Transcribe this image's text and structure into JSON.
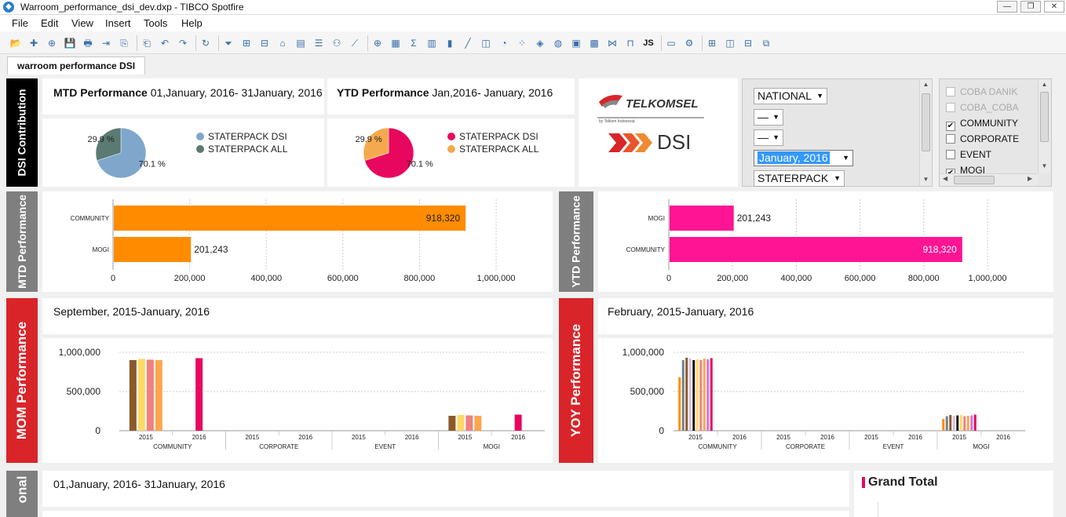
{
  "window": {
    "title": "Warroom_performance_dsi_dev.dxp - TIBCO Spotfire",
    "min": "—",
    "max": "❐",
    "close": "✕"
  },
  "menu": [
    "File",
    "Edit",
    "View",
    "Insert",
    "Tools",
    "Help"
  ],
  "toolbar_icons": [
    "open-icon",
    "new-icon",
    "add-data-icon",
    "save-icon",
    "print-icon",
    "export-icon",
    "copy-icon",
    "paste-icon",
    "undo-icon",
    "redo-icon",
    "reload-icon",
    "filter-icon",
    "details-icon",
    "bookmark-icon",
    "tag-icon",
    "page-icon",
    "lists-icon",
    "collaboration-icon",
    "trend-icon",
    "new-page-icon",
    "table-icon",
    "crosstable-icon",
    "graphical-table-icon",
    "bar-chart-icon",
    "line-chart-icon",
    "combination-chart-icon",
    "pie-chart-icon",
    "scatter-icon",
    "3d-scatter-icon",
    "map-icon",
    "treemap-icon",
    "heatmap-icon",
    "parallel-coordinates-icon",
    "box-plot-icon",
    "js-icon",
    "text-area-icon",
    "settings-icon",
    "layout-icon-1",
    "layout-icon-2",
    "layout-icon-3",
    "layout-icon-4"
  ],
  "tab": "warroom performance DSI",
  "colors": {
    "blue": "#7fa7cc",
    "slate": "#5a7a72",
    "pink": "#e8075f",
    "peach": "#f5a94e",
    "orange": "#ff8c00",
    "gray_label": "#7f7f7f",
    "red_label": "#d9252a",
    "black_label": "#000000"
  },
  "dsi_contribution": {
    "label": "DSI Contribution",
    "mtd": {
      "title_bold": "MTD Performance",
      "title_rest": " 01,January, 2016- 31January, 2016",
      "legend": [
        "STATERPACK DSI",
        "STATERPACK ALL"
      ]
    },
    "ytd": {
      "title_bold": "YTD Performance",
      "title_rest": " Jan,2016- January, 2016",
      "legend": [
        "STATERPACK DSI",
        "STATERPACK ALL"
      ]
    }
  },
  "logo": {
    "brand": "TELKOMSEL",
    "sub": "by Telkom Indonesia",
    "product": "DSI"
  },
  "filters": {
    "dropdowns": [
      "NATIONAL",
      "—",
      "—",
      "January, 2016",
      "STATERPACK"
    ],
    "checkboxes": [
      {
        "label": "COBA DANIK",
        "checked": false,
        "dim": true
      },
      {
        "label": "COBA_COBA",
        "checked": false,
        "dim": true
      },
      {
        "label": "COMMUNITY",
        "checked": true,
        "dim": false
      },
      {
        "label": "CORPORATE",
        "checked": false,
        "dim": false
      },
      {
        "label": "EVENT",
        "checked": false,
        "dim": false
      },
      {
        "label": "MOGI",
        "checked": true,
        "dim": false
      }
    ]
  },
  "mtd_perf": {
    "label": "MTD Performance"
  },
  "ytd_perf": {
    "label": "YTD Performance"
  },
  "mom": {
    "label": "MOM Performance",
    "title": "September, 2015-January, 2016"
  },
  "yoy": {
    "label": "YOY Performance",
    "title": "February, 2015-January, 2016"
  },
  "bottom": {
    "label": "onal",
    "title": "01,January, 2016- 31January, 2016",
    "grand_total": "Grand Total"
  },
  "chart_data": [
    {
      "type": "pie",
      "title": "MTD Performance",
      "labels": [
        "STATERPACK DSI",
        "STATERPACK ALL"
      ],
      "values": [
        70.1,
        29.9
      ],
      "value_labels": [
        "70.1 %",
        "29.9 %"
      ],
      "colors": [
        "#7fa7cc",
        "#5a7a72"
      ]
    },
    {
      "type": "pie",
      "title": "YTD Performance",
      "labels": [
        "STATERPACK DSI",
        "STATERPACK ALL"
      ],
      "values": [
        70.1,
        29.9
      ],
      "value_labels": [
        "70.1 %",
        "29.9 %"
      ],
      "colors": [
        "#e8075f",
        "#f5a94e"
      ]
    },
    {
      "type": "bar",
      "orientation": "horizontal",
      "categories": [
        "COMMUNITY",
        "MOGI"
      ],
      "values": [
        918320,
        201243
      ],
      "value_labels": [
        "918,320",
        "201,243"
      ],
      "xlim": [
        0,
        1000000
      ],
      "ticks": [
        "0",
        "200,000",
        "400,000",
        "600,000",
        "800,000",
        "1,000,000"
      ],
      "color": "#ff8c00"
    },
    {
      "type": "bar",
      "orientation": "horizontal",
      "categories": [
        "MOGI",
        "COMMUNITY"
      ],
      "values": [
        201243,
        918320
      ],
      "value_labels": [
        "201,243",
        "918,320"
      ],
      "xlim": [
        0,
        1000000
      ],
      "ticks": [
        "0",
        "200,000",
        "400,000",
        "600,000",
        "800,000",
        "1,000,000"
      ],
      "color": "#ff1493"
    },
    {
      "type": "bar",
      "title": "September, 2015-January, 2016",
      "groups": [
        "COMMUNITY",
        "CORPORATE",
        "EVENT",
        "MOGI"
      ],
      "years": [
        "2015",
        "2016"
      ],
      "ylim": [
        0,
        1000000
      ],
      "yticks": [
        "0",
        "500,000",
        "1,000,000"
      ],
      "bars": [
        {
          "group": 0,
          "year": 0,
          "values": [
            900000,
            915000,
            905000,
            900000
          ],
          "colors": [
            "#8b5a2b",
            "#ffd966",
            "#f08080",
            "#ffa64d"
          ]
        },
        {
          "group": 0,
          "year": 1,
          "values": [
            925000
          ],
          "colors": [
            "#e8075f"
          ]
        },
        {
          "group": 3,
          "year": 0,
          "values": [
            190000,
            200000,
            195000,
            190000
          ],
          "colors": [
            "#8b5a2b",
            "#ffd966",
            "#f08080",
            "#ffa64d"
          ]
        },
        {
          "group": 3,
          "year": 1,
          "values": [
            205000
          ],
          "colors": [
            "#e8075f"
          ]
        }
      ]
    },
    {
      "type": "bar",
      "title": "February, 2015-January, 2016",
      "groups": [
        "COMMUNITY",
        "CORPORATE",
        "EVENT",
        "MOGI"
      ],
      "years": [
        "2015",
        "2016"
      ],
      "ylim": [
        0,
        1000000
      ],
      "yticks": [
        "0",
        "500,000",
        "1,000,000"
      ],
      "bars": [
        {
          "group": 0,
          "year": 0,
          "values": [
            680000,
            900000,
            930000,
            920000,
            900000,
            910000,
            900000,
            920000,
            910000,
            925000
          ],
          "colors": [
            "#ff8c00",
            "#708090",
            "#8b5a2b",
            "#d8bfd8",
            "#111111",
            "#ffd966",
            "#f08080",
            "#ffa64d",
            "#da70d6",
            "#e8075f"
          ]
        },
        {
          "group": 3,
          "year": 0,
          "values": [
            150000,
            185000,
            200000,
            190000,
            195000,
            200000,
            185000,
            190000,
            195000,
            205000
          ],
          "colors": [
            "#ff8c00",
            "#708090",
            "#8b5a2b",
            "#d8bfd8",
            "#111111",
            "#ffd966",
            "#f08080",
            "#ffa64d",
            "#da70d6",
            "#e8075f"
          ]
        }
      ]
    }
  ]
}
